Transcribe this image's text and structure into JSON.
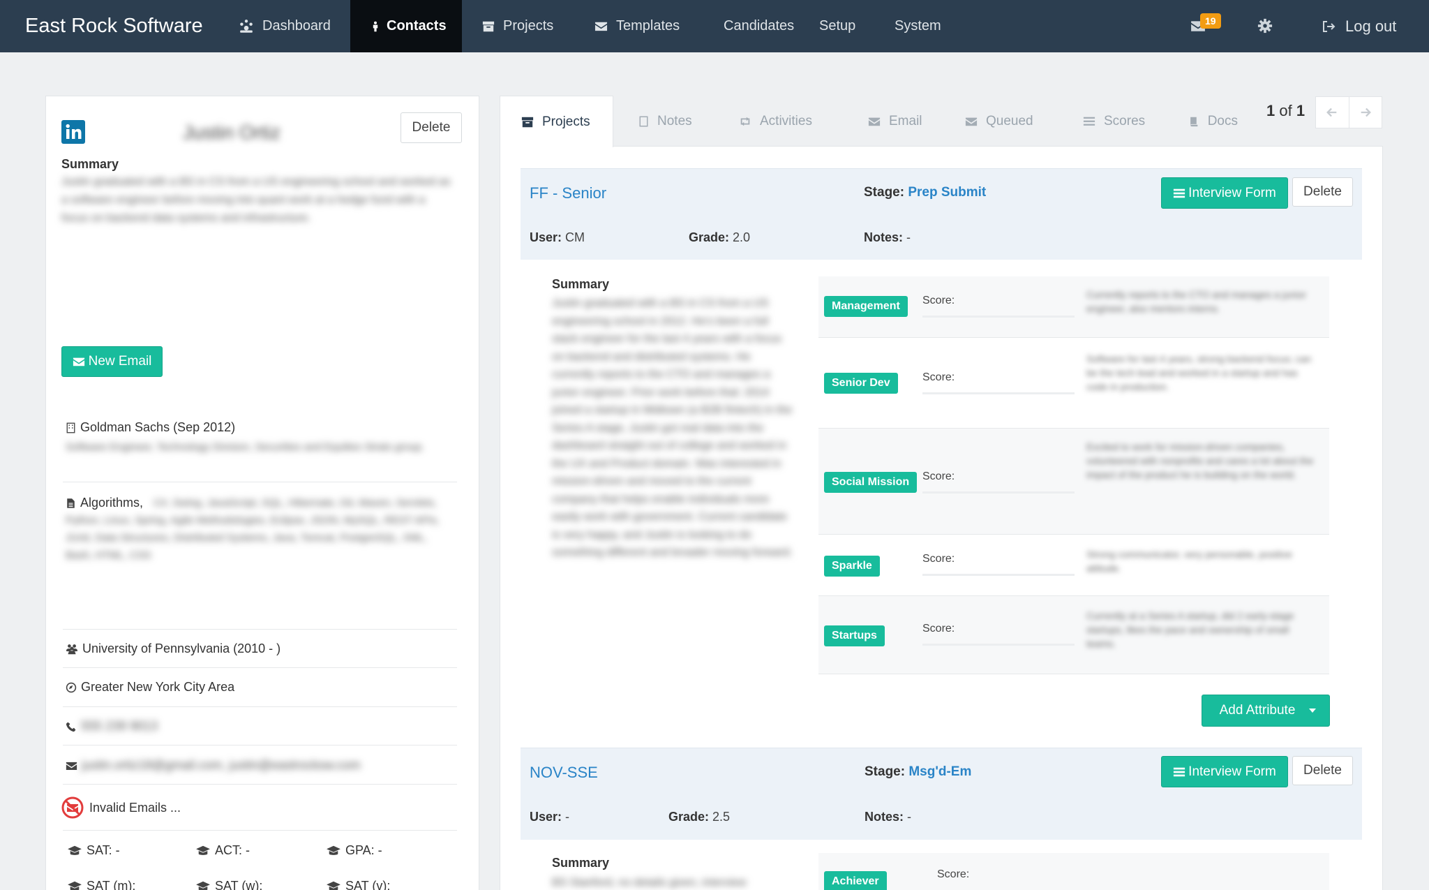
{
  "navbar": {
    "brand": "East Rock Software",
    "items": [
      {
        "label": "Dashboard",
        "icon": "dashboard-icon"
      },
      {
        "label": "Contacts",
        "icon": "person-icon"
      },
      {
        "label": "Projects",
        "icon": "archive-icon"
      },
      {
        "label": "Templates",
        "icon": "envelope-icon"
      },
      {
        "label": "Candidates"
      },
      {
        "label": "Setup"
      },
      {
        "label": "System"
      }
    ],
    "active_item": "Contacts",
    "notification_count": "19",
    "logout_label": "Log out"
  },
  "contact": {
    "name": "Justin Ortiz",
    "delete_label": "Delete",
    "summary_heading": "Summary",
    "summary_text": "Justin graduated with a BS in CS from a US engineering school and worked as a software engineer before moving into quant work at a hedge fund with a focus on backend data systems and infrastructure.",
    "new_email_label": "New Email",
    "company": "Goldman Sachs (Sep 2012)",
    "company_detail": "Software Engineer, Technology Division, Securities and Equities Strats group.",
    "skills_lead": "Algorithms,",
    "skills_text": "C#, Swing, JavaScript, SQL, Hibernate, Git, Maven, Servlets, Python, Linux, Spring, Agile Methodologies, Eclipse, JSON, MySQL, REST APIs, JUnit, Data Structures, Distributed Systems, Java, Tomcat, PostgreSQL, XML, Bash, HTML, CSS",
    "school": "University of Pennsylvania (2010 - )",
    "location": "Greater New York City Area",
    "phone": "555 239 9013",
    "emails": "justin.ortiz18@gmail.com, justin@eastrocksw.com",
    "invalid_emails": "Invalid Emails ...",
    "scores_row1": [
      {
        "label": "SAT: -"
      },
      {
        "label": "ACT: -"
      },
      {
        "label": "GPA: -"
      }
    ],
    "scores_row2": [
      {
        "label": "SAT (m):"
      },
      {
        "label": "SAT (w):"
      },
      {
        "label": "SAT (v):"
      }
    ]
  },
  "tabs": {
    "items": [
      {
        "label": "Projects",
        "icon": "archive-icon"
      },
      {
        "label": "Notes",
        "icon": "document-icon"
      },
      {
        "label": "Activities",
        "icon": "retweet-icon"
      },
      {
        "label": "Email",
        "icon": "envelope-icon"
      },
      {
        "label": "Queued",
        "icon": "envelope-icon"
      },
      {
        "label": "Scores",
        "icon": "list-icon"
      },
      {
        "label": "Docs",
        "icon": "book-icon"
      }
    ],
    "active": "Projects"
  },
  "pager": {
    "current": "1",
    "of_label": "of",
    "total": "1"
  },
  "projects": [
    {
      "name": "FF - Senior",
      "stage_label": "Stage:",
      "stage": "Prep Submit",
      "interview_form_label": "Interview Form",
      "delete_label": "Delete",
      "user_label": "User:",
      "user": "CM",
      "grade_label": "Grade:",
      "grade": "2.0",
      "notes_label": "Notes:",
      "notes": "-",
      "summary_heading": "Summary",
      "summary_text": "Justin graduated with a BS in CS from a US engineering school in 2012. He's been a full stack engineer for the last 4 years with a focus on backend and distributed systems. He currently reports to the CTO and manages a junior engineer. Prior work before that: 2014 joined a startup in Midtown (a B2B fintech) in the Series A stage, Justin got real data into the dashboard straight out of college and worked in the UX and Product domain. Was interested in mission-driven and moved to the current company that helps enable individuals more easily work with government. Current candidate is very happy, and Justin is looking to do something different and broader moving forward.",
      "attributes": [
        {
          "tag": "Management",
          "score_label": "Score:",
          "note": "Currently reports to the CTO and manages a junior engineer, also mentors interns."
        },
        {
          "tag": "Senior Dev",
          "score_label": "Score:",
          "note": "Software for last 4 years, strong backend focus; can be the tech lead and worked in a startup and has code in production."
        },
        {
          "tag": "Social Mission",
          "score_label": "Score:",
          "note": "Excited to work for mission-driven companies, volunteered with nonprofits and cares a lot about the impact of the product he is building on the world."
        },
        {
          "tag": "Sparkle",
          "score_label": "Score:",
          "note": "Strong communicator, very personable, positive attitude."
        },
        {
          "tag": "Startups",
          "score_label": "Score:",
          "note": "Currently at a Series A startup, did 2 early-stage startups, likes the pace and ownership of small teams."
        }
      ],
      "add_attribute_label": "Add Attribute"
    },
    {
      "name": "NOV-SSE",
      "stage_label": "Stage:",
      "stage": "Msg'd-Em",
      "interview_form_label": "Interview Form",
      "delete_label": "Delete",
      "user_label": "User:",
      "user": "-",
      "grade_label": "Grade:",
      "grade": "2.5",
      "notes_label": "Notes:",
      "notes": "-",
      "summary_heading": "Summary",
      "summary_text": "BS Stanford, no details given, interview scheduled.",
      "attributes": [
        {
          "tag": "Achiever",
          "score_label": "Score:"
        }
      ]
    }
  ],
  "colors": {
    "navbar": "#2c3e50",
    "active_nav": "#0a0e12",
    "accent": "#18bc9c",
    "link": "#2a84c7",
    "badge": "#f39c12"
  }
}
